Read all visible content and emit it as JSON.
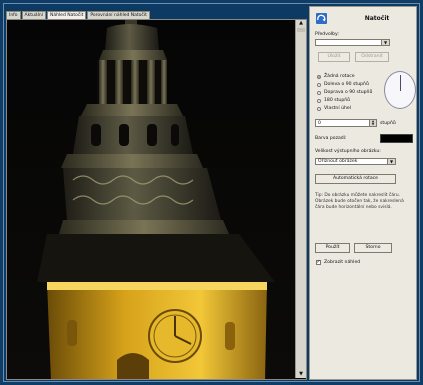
{
  "tabs": [
    {
      "label": "Info",
      "active": false
    },
    {
      "label": "Aktuální",
      "active": false
    },
    {
      "label": "Náhled Natočit",
      "active": true
    },
    {
      "label": "Porovnání náhled Natočit",
      "active": false
    }
  ],
  "panel": {
    "title": "Natočit",
    "presets_label": "Předvolby:",
    "preset_value": "",
    "save_label": "Uložit",
    "delete_label": "Odstranit",
    "rotation_options": [
      {
        "label": "Žádná rotace",
        "selected": true
      },
      {
        "label": "Doleva o 90 stupňů",
        "selected": false
      },
      {
        "label": "Doprava o 90 stupňů",
        "selected": false
      },
      {
        "label": "180 stupňů",
        "selected": false
      },
      {
        "label": "Vlastní úhel",
        "selected": false
      }
    ],
    "angle_value": "0",
    "angle_unit": "stupňů",
    "bg_color_label": "Barva pozadí:",
    "bg_color": "#000000",
    "size_label": "Velikost výstupního obrázku:",
    "size_value": "Oříznout obrázek",
    "auto_rotate_label": "Automatická rotace",
    "tip": "Tip: Do obrázku můžete nakreslit čáru. Obrázek bude otočen tak, že nakreslená čára bude horizontální nebo svislá.",
    "apply_label": "Použít",
    "cancel_label": "Storno",
    "preview_label": "Zobrazit náhled",
    "preview_checked": true
  }
}
